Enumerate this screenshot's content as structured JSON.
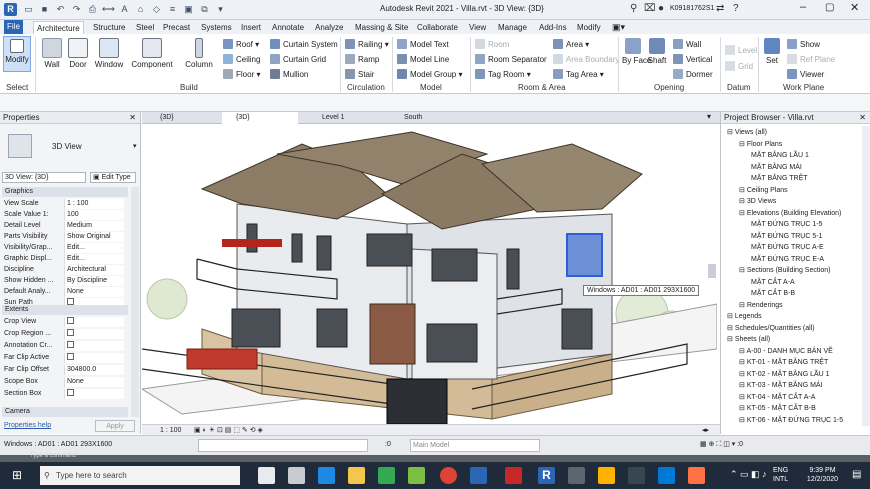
{
  "title": "Autodesk Revit 2021 - Villa.rvt - 3D View: {3D}",
  "user": "K09181762S1",
  "tabs": [
    "File",
    "Architecture",
    "Structure",
    "Steel",
    "Precast",
    "Systems",
    "Insert",
    "Annotate",
    "Analyze",
    "Massing & Site",
    "Collaborate",
    "View",
    "Manage",
    "Add-Ins",
    "Modify"
  ],
  "active_tab": "Architecture",
  "ribbon": {
    "modify": "Modify",
    "select": "Select",
    "build": {
      "label": "Build",
      "wall": "Wall",
      "door": "Door",
      "window": "Window",
      "component": "Component",
      "column": "Column",
      "roof": "Roof",
      "ceiling": "Ceiling",
      "floor": "Floor",
      "curtain_system": "Curtain System",
      "curtain_grid": "Curtain Grid",
      "mullion": "Mullion"
    },
    "circulation": {
      "label": "Circulation",
      "railing": "Railing",
      "ramp": "Ramp",
      "stair": "Stair"
    },
    "model": {
      "label": "Model",
      "model_text": "Model Text",
      "model_line": "Model Line",
      "model_group": "Model Group"
    },
    "room_area": {
      "label": "Room & Area",
      "room": "Room",
      "room_separator": "Room Separator",
      "tag_room": "Tag Room",
      "area": "Area",
      "area_boundary": "Area Boundary",
      "tag_area": "Tag Area"
    },
    "opening": {
      "label": "Opening",
      "by_face": "By Face",
      "shaft": "Shaft",
      "wall": "Wall",
      "vertical": "Vertical",
      "dormer": "Dormer"
    },
    "datum": {
      "label": "Datum",
      "level": "Level",
      "grid": "Grid"
    },
    "work_plane": {
      "label": "Work Plane",
      "set": "Set",
      "show": "Show",
      "ref_plane": "Ref Plane",
      "viewer": "Viewer"
    }
  },
  "properties": {
    "header": "Properties",
    "type_name": "3D View",
    "selector": "3D View: {3D}",
    "edit_type": "Edit Type",
    "sections": {
      "graphics": "Graphics",
      "extents": "Extents",
      "camera": "Camera"
    },
    "rows": [
      {
        "k": "View Scale",
        "v": "1 : 100"
      },
      {
        "k": "Scale Value  1:",
        "v": "100"
      },
      {
        "k": "Detail Level",
        "v": "Medium"
      },
      {
        "k": "Parts Visibility",
        "v": "Show Original"
      },
      {
        "k": "Visibility/Grap...",
        "v": "Edit..."
      },
      {
        "k": "Graphic Displ...",
        "v": "Edit..."
      },
      {
        "k": "Discipline",
        "v": "Architectural"
      },
      {
        "k": "Show Hidden ...",
        "v": "By Discipline"
      },
      {
        "k": "Default Analy...",
        "v": "None"
      },
      {
        "k": "Sun Path",
        "v": ""
      }
    ],
    "extent_rows": [
      {
        "k": "Crop View",
        "v": ""
      },
      {
        "k": "Crop Region ...",
        "v": ""
      },
      {
        "k": "Annotation Cr...",
        "v": ""
      },
      {
        "k": "Far Clip Active",
        "v": ""
      },
      {
        "k": "Far Clip Offset",
        "v": "304800.0"
      },
      {
        "k": "Scope Box",
        "v": "None"
      },
      {
        "k": "Section Box",
        "v": ""
      }
    ],
    "help": "Properties help",
    "apply": "Apply"
  },
  "view_tabs": [
    "{3D}",
    "{3D}",
    "Level 1",
    "South"
  ],
  "tooltip": "Windows : AD01 : AD01 293X1600",
  "view_scale": "1 : 100",
  "browser": {
    "header": "Project Browser - Villa.rvt",
    "nodes": [
      {
        "t": "Views (all)",
        "l": 0
      },
      {
        "t": "Floor Plans",
        "l": 1
      },
      {
        "t": "MẶT BẰNG LẦU 1",
        "l": 2
      },
      {
        "t": "MẶT BẰNG MÁI",
        "l": 2
      },
      {
        "t": "MẶT BẰNG TRỆT",
        "l": 2
      },
      {
        "t": "Ceiling Plans",
        "l": 1
      },
      {
        "t": "3D Views",
        "l": 1
      },
      {
        "t": "Elevations (Building Elevation)",
        "l": 1
      },
      {
        "t": "MẶT ĐỨNG TRỤC 1-5",
        "l": 2
      },
      {
        "t": "MẶT ĐỨNG TRỤC 5-1",
        "l": 2
      },
      {
        "t": "MẶT ĐỨNG TRỤC A-E",
        "l": 2
      },
      {
        "t": "MẶT ĐỨNG TRỤC E-A",
        "l": 2
      },
      {
        "t": "Sections (Building Section)",
        "l": 1
      },
      {
        "t": "MẶT CẮT A-A",
        "l": 2
      },
      {
        "t": "MẶT CẮT B-B",
        "l": 2
      },
      {
        "t": "Renderings",
        "l": 1
      },
      {
        "t": "Legends",
        "l": 0
      },
      {
        "t": "Schedules/Quantities (all)",
        "l": 0
      },
      {
        "t": "Sheets (all)",
        "l": 0
      },
      {
        "t": "A-00 - DANH MỤC BẢN VẼ",
        "l": 1
      },
      {
        "t": "KT-01 - MẶT BẰNG TRỆT",
        "l": 1
      },
      {
        "t": "KT-02 - MẶT BẰNG LẦU 1",
        "l": 1
      },
      {
        "t": "KT-03 - MẶT BẰNG MÁI",
        "l": 1
      },
      {
        "t": "KT-04 - MẶT CẮT A-A",
        "l": 1
      },
      {
        "t": "KT-05 - MẶT CẮT B-B",
        "l": 1
      },
      {
        "t": "KT-06 - MẶT ĐỨNG TRỤC 1-5",
        "l": 1
      }
    ]
  },
  "status": {
    "text": "Windows : AD01 : AD01 293X1600",
    "zero": ":0",
    "main_model": "Main Model"
  },
  "command_line": "Type a command",
  "taskbar": {
    "search": "Type here to search",
    "lang": "ENG",
    "lang2": "INTL",
    "time": "9:39 PM",
    "date": "12/2/2020"
  },
  "colors": {
    "accent": "#2b66b5",
    "taskbar": "#1f2b3a",
    "roof": "#8c7c66",
    "selection": "#2f5fd6"
  }
}
